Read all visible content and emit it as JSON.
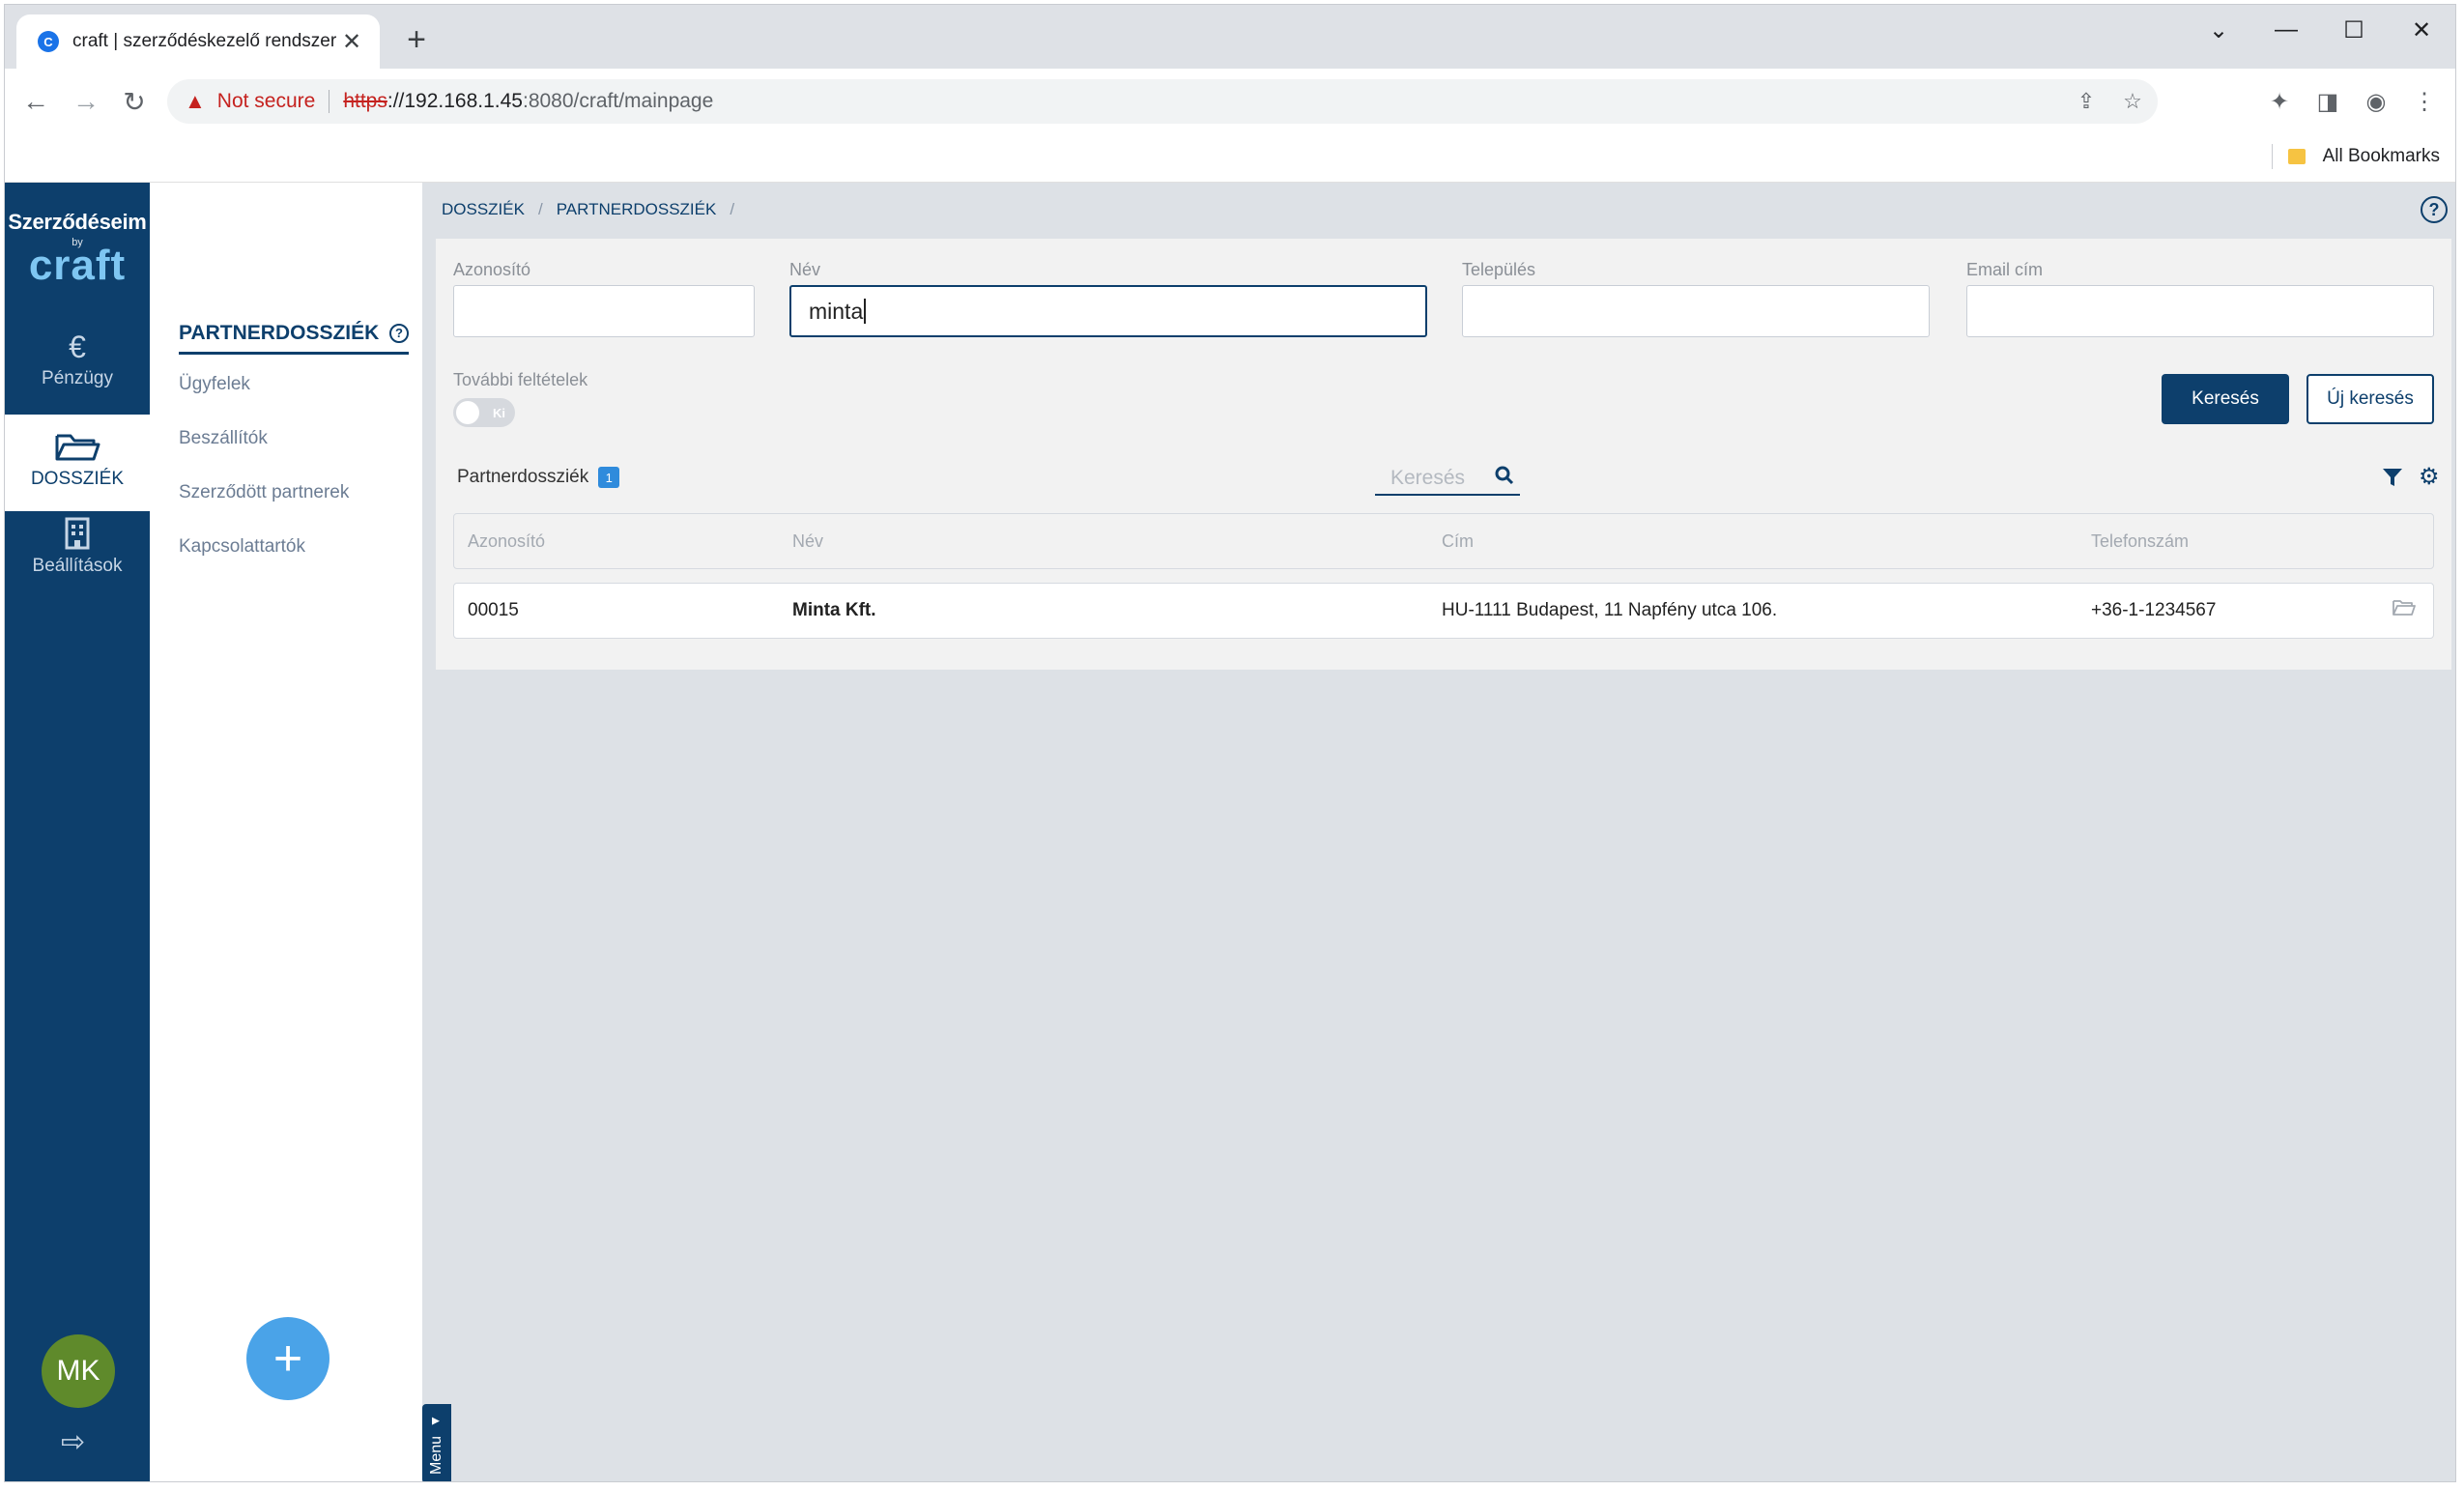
{
  "browser": {
    "tab_title": "craft | szerződéskezelő rendszer",
    "favicon_letter": "C",
    "url_warning": "Not secure",
    "url_scheme": "https",
    "url_host": "://192.168.1.45",
    "url_path": ":8080/craft/mainpage",
    "bookmarks_label": "All Bookmarks"
  },
  "brand": {
    "line1": "Szerződéseim",
    "line2": "by",
    "line3": "craft"
  },
  "rail": {
    "items": [
      {
        "label": "Pénzügy",
        "icon": "euro-icon"
      },
      {
        "label": "DOSSZIÉK",
        "icon": "folder-open-icon",
        "active": true
      },
      {
        "label": "Beállítások",
        "icon": "building-icon"
      }
    ],
    "user_initials": "MK"
  },
  "subnav": {
    "title": "PARTNERDOSSZIÉK",
    "links": [
      "Ügyfelek",
      "Beszállítók",
      "Szerződött partnerek",
      "Kapcsolattartók"
    ],
    "menu_label": "Menu"
  },
  "breadcrumb": [
    "DOSSZIÉK",
    "PARTNERDOSSZIÉK"
  ],
  "filters": {
    "azonosito": {
      "label": "Azonosító",
      "value": ""
    },
    "nev": {
      "label": "Név",
      "value": "minta"
    },
    "telepules": {
      "label": "Település",
      "value": ""
    },
    "email": {
      "label": "Email cím",
      "value": ""
    },
    "more_label": "További feltételek",
    "toggle_text": "Ki",
    "search_button": "Keresés",
    "new_search_button": "Új keresés"
  },
  "list": {
    "title": "Partnerdossziék",
    "count": "1",
    "search_placeholder": "Keresés",
    "columns": [
      "Azonosító",
      "Név",
      "Cím",
      "Telefonszám"
    ],
    "rows": [
      {
        "id": "00015",
        "name": "Minta Kft.",
        "address": "HU-1111 Budapest, 11 Napfény utca 106.",
        "phone": "+36-1-1234567"
      }
    ]
  },
  "colors": {
    "primary": "#0d3f6c",
    "accent": "#4aa3e8",
    "background": "#dde1e6"
  }
}
